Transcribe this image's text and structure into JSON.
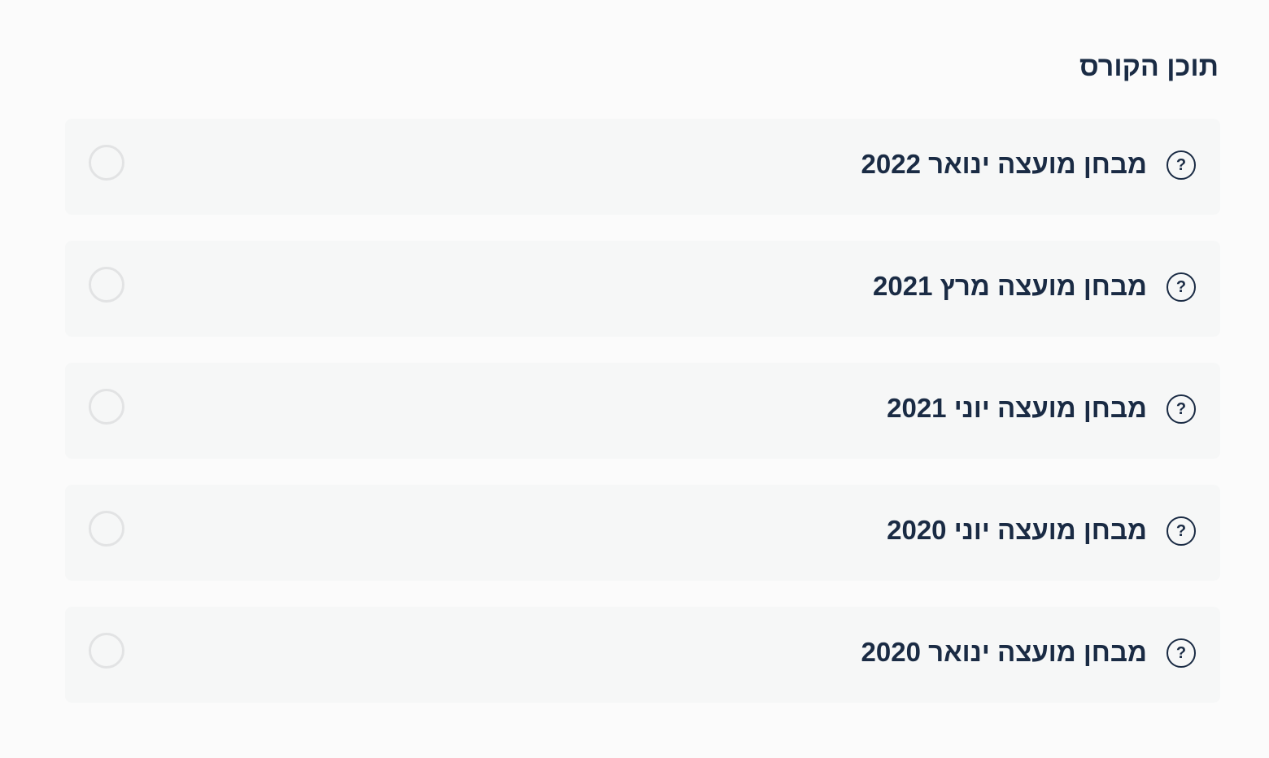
{
  "course": {
    "section_title": "תוכן הקורס",
    "lessons": [
      {
        "title": "מבחן מועצה ינואר 2022",
        "icon": "quiz-question-icon",
        "icon_glyph": "?",
        "completed": false
      },
      {
        "title": "מבחן מועצה מרץ 2021",
        "icon": "quiz-question-icon",
        "icon_glyph": "?",
        "completed": false
      },
      {
        "title": "מבחן מועצה יוני 2021",
        "icon": "quiz-question-icon",
        "icon_glyph": "?",
        "completed": false
      },
      {
        "title": "מבחן מועצה יוני 2020",
        "icon": "quiz-question-icon",
        "icon_glyph": "?",
        "completed": false
      },
      {
        "title": "מבחן מועצה ינואר 2020",
        "icon": "quiz-question-icon",
        "icon_glyph": "?",
        "completed": false
      }
    ]
  },
  "colors": {
    "page_background": "#fbfbfb",
    "row_background": "#f6f7f7",
    "text": "#1a2b44",
    "status_circle": "#e2e3e4"
  }
}
